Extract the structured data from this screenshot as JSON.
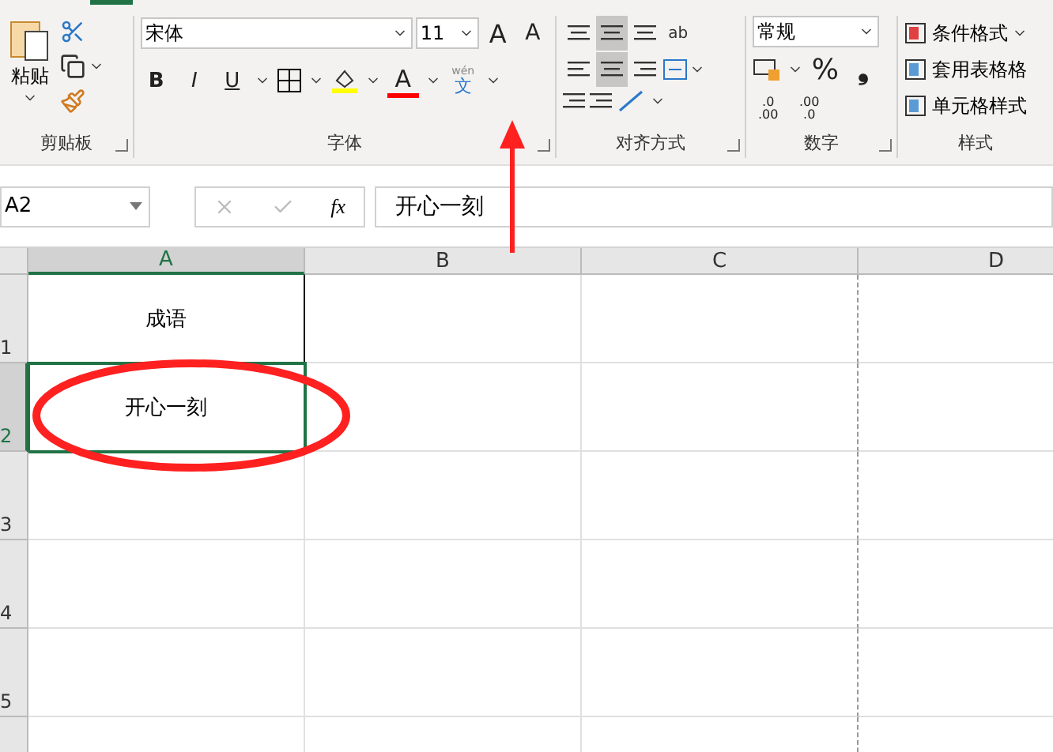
{
  "ribbon": {
    "clipboard": {
      "paste_label": "粘贴",
      "group_label": "剪贴板"
    },
    "font": {
      "font_name": "宋体",
      "font_size": "11",
      "grow": "A",
      "shrink": "A",
      "format_buttons": [
        "B",
        "I",
        "U"
      ],
      "font_color_letter": "A",
      "phonetic_ruby": "wén",
      "phonetic_glyph": "文",
      "group_label": "字体"
    },
    "alignment": {
      "vertical": [
        {
          "selected": false
        },
        {
          "selected": true
        },
        {
          "selected": false
        }
      ],
      "horizontal": [
        {
          "selected": false
        },
        {
          "selected": true
        },
        {
          "selected": false
        }
      ],
      "wrap_text": "ab",
      "group_label": "对齐方式"
    },
    "number": {
      "format": "常规",
      "percent": "%",
      "comma": "❟",
      "decimal_more": [
        ".0",
        ".00"
      ],
      "decimal_less": [
        ".00",
        ".0"
      ],
      "group_label": "数字"
    },
    "styles": {
      "items": [
        {
          "label": "条件格式",
          "has_menu": true
        },
        {
          "label": "套用表格格",
          "has_menu": false
        },
        {
          "label": "单元格样式",
          "has_menu": false
        }
      ],
      "group_label": "样式"
    }
  },
  "formula_bar": {
    "name_box": "A2",
    "fx": "fx",
    "value": "开心一刻"
  },
  "sheet": {
    "columns": [
      {
        "label": "A",
        "selected": true
      },
      {
        "label": "B",
        "selected": false
      },
      {
        "label": "C",
        "selected": false
      },
      {
        "label": "D",
        "selected": false
      }
    ],
    "rows": [
      {
        "label": "1",
        "selected": false,
        "cells": [
          "成语",
          "",
          "",
          ""
        ]
      },
      {
        "label": "2",
        "selected": true,
        "cells": [
          "开心一刻",
          "",
          "",
          ""
        ]
      },
      {
        "label": "3",
        "selected": false,
        "cells": [
          "",
          "",
          "",
          ""
        ]
      },
      {
        "label": "4",
        "selected": false,
        "cells": [
          "",
          "",
          "",
          ""
        ]
      },
      {
        "label": "5",
        "selected": false,
        "cells": [
          "",
          "",
          "",
          ""
        ]
      }
    ]
  }
}
